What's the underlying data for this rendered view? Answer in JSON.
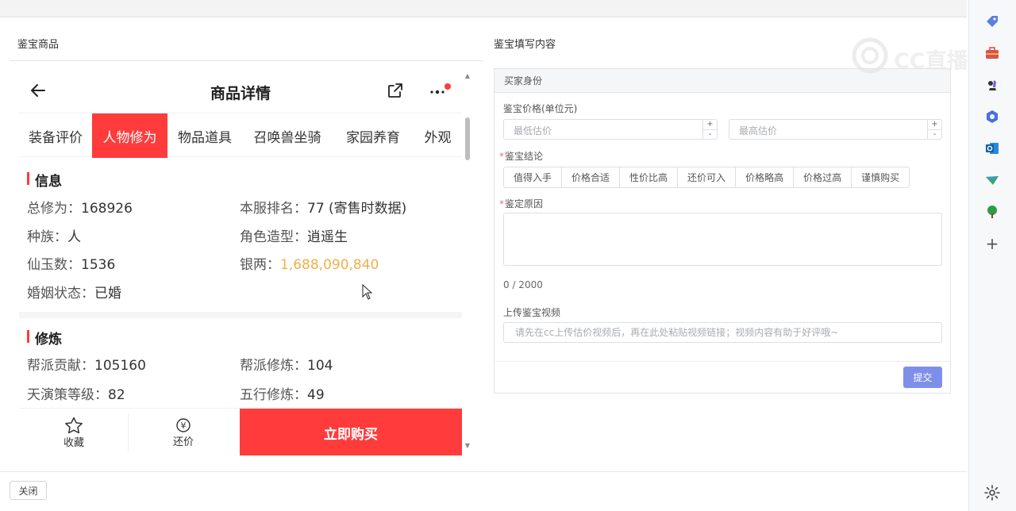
{
  "left_panel": {
    "title": "鉴宝商品",
    "phone": {
      "header_title": "商品详情",
      "tabs": [
        "装备评价",
        "人物修为",
        "物品道具",
        "召唤兽坐骑",
        "家园养育",
        "外观"
      ],
      "active_tab": "人物修为",
      "info": {
        "heading": "信息",
        "rows": [
          {
            "label": "总修为：",
            "value": "168926"
          },
          {
            "label": "本服排名：",
            "value": "77 (寄售时数据)"
          },
          {
            "label": "种族：",
            "value": "人"
          },
          {
            "label": "角色造型：",
            "value": "逍遥生"
          },
          {
            "label": "仙玉数：",
            "value": "1536"
          },
          {
            "label": "银两：",
            "value": "1,688,090,840"
          },
          {
            "label": "婚姻状态：",
            "value": "已婚"
          }
        ]
      },
      "cultivation": {
        "heading": "修炼",
        "rows": [
          {
            "label": "帮派贡献：",
            "value": "105160"
          },
          {
            "label": "帮派修炼：",
            "value": "104"
          },
          {
            "label": "天演策等级：",
            "value": "82"
          },
          {
            "label": "五行修炼：",
            "value": "49"
          }
        ]
      },
      "footer": {
        "favorite": "收藏",
        "bargain": "还价",
        "bargain_symbol": "¥",
        "buy": "立即购买"
      }
    }
  },
  "right_panel": {
    "title": "鉴宝填写内容",
    "form_head": "买家身份",
    "price_label": "鉴宝价格(单位元)",
    "min_placeholder": "最低估价",
    "max_placeholder": "最高估价",
    "conclusion_label": "鉴宝结论",
    "conclusions": [
      "值得入手",
      "价格合适",
      "性价比高",
      "还价可入",
      "价格略高",
      "价格过高",
      "谨慎购买"
    ],
    "reason_label": "鉴定原因",
    "counter": "0 / 2000",
    "video_label": "上传鉴宝视频",
    "video_placeholder": "请先在cc上传估价视频后，再在此处粘贴视频链接；视频内容有助于好评哦~",
    "submit": "提交",
    "required_mark": "*",
    "stepper_plus": "+",
    "stepper_minus": "-"
  },
  "bottom": {
    "close": "关闭"
  },
  "watermark": {
    "text": "CC直播"
  },
  "colors": {
    "accent_red": "#ff3b3b",
    "gold": "#f0b04a",
    "submit_blue": "#7e8fe9"
  }
}
